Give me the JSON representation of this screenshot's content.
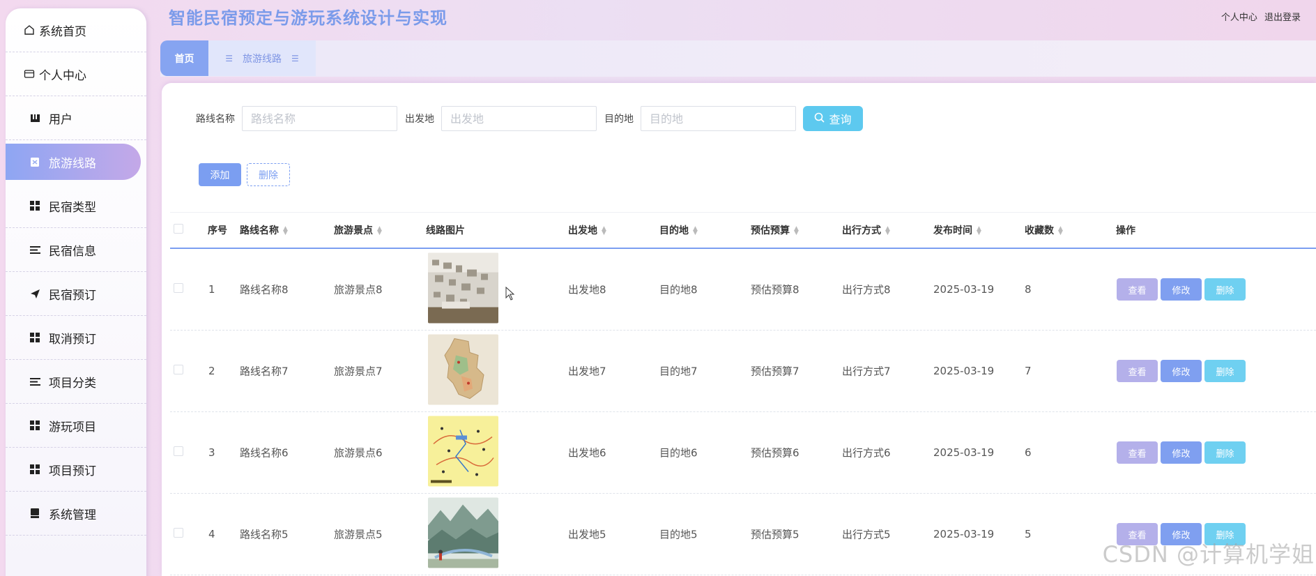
{
  "app": {
    "title": "智能民宿预定与游玩系统设计与实现",
    "personal_center": "个人中心",
    "logout": "退出登录"
  },
  "sidebar": {
    "items": [
      {
        "label": "系统首页",
        "icon": "home-icon"
      },
      {
        "label": "个人中心",
        "icon": "id-card-icon"
      },
      {
        "label": "用户",
        "icon": "user-icon"
      },
      {
        "label": "旅游线路",
        "icon": "route-icon",
        "active": true
      },
      {
        "label": "民宿类型",
        "icon": "grid-icon"
      },
      {
        "label": "民宿信息",
        "icon": "list-icon"
      },
      {
        "label": "民宿预订",
        "icon": "send-icon"
      },
      {
        "label": "取消预订",
        "icon": "grid-icon"
      },
      {
        "label": "项目分类",
        "icon": "list-icon"
      },
      {
        "label": "游玩项目",
        "icon": "grid-icon"
      },
      {
        "label": "项目预订",
        "icon": "grid-icon"
      },
      {
        "label": "系统管理",
        "icon": "settings-icon"
      }
    ]
  },
  "tabs": {
    "home": "首页",
    "route": "旅游线路"
  },
  "search": {
    "route_name_label": "路线名称",
    "route_name_placeholder": "路线名称",
    "departure_label": "出发地",
    "departure_placeholder": "出发地",
    "destination_label": "目的地",
    "destination_placeholder": "目的地",
    "query_label": "查询"
  },
  "actions": {
    "add": "添加",
    "delete": "删除"
  },
  "table": {
    "columns": [
      "序号",
      "路线名称",
      "旅游景点",
      "线路图片",
      "出发地",
      "目的地",
      "预估预算",
      "出行方式",
      "发布时间",
      "收藏数",
      "操作"
    ],
    "rows": [
      {
        "index": "1",
        "name": "路线名称8",
        "spot": "旅游景点8",
        "image": "photo-wall",
        "departure": "出发地8",
        "destination": "目的地8",
        "budget": "预估预算8",
        "mode": "出行方式8",
        "time": "2025-03-19",
        "favorites": "8"
      },
      {
        "index": "2",
        "name": "路线名称7",
        "spot": "旅游景点7",
        "image": "map-region",
        "departure": "出发地7",
        "destination": "目的地7",
        "budget": "预估预算7",
        "mode": "出行方式7",
        "time": "2025-03-19",
        "favorites": "7"
      },
      {
        "index": "3",
        "name": "路线名称6",
        "spot": "旅游景点6",
        "image": "yellow-route-map",
        "departure": "出发地6",
        "destination": "目的地6",
        "budget": "预估预算6",
        "mode": "出行方式6",
        "time": "2025-03-19",
        "favorites": "6"
      },
      {
        "index": "4",
        "name": "路线名称5",
        "spot": "旅游景点5",
        "image": "mountain-illustration",
        "departure": "出发地5",
        "destination": "目的地5",
        "budget": "预估预算5",
        "mode": "出行方式5",
        "time": "2025-03-19",
        "favorites": "5"
      }
    ],
    "row_buttons": {
      "view": "查看",
      "edit": "修改",
      "delete": "删除"
    }
  },
  "watermark": "CSDN @计算机学姐",
  "colors": {
    "accent": "#7b9ef1",
    "title": "#7b9bea",
    "query": "#5dc9ef",
    "view": "#b4b0ea",
    "edit": "#7f9ff0",
    "delete": "#6fd0f1"
  }
}
